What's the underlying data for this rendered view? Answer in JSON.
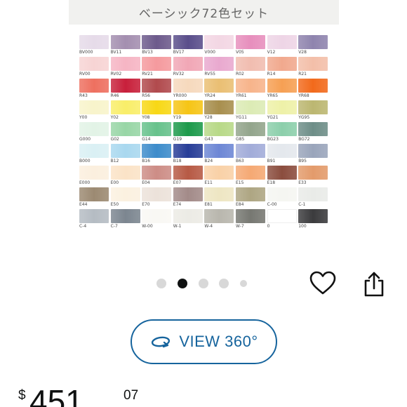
{
  "header": {
    "title": "ベーシック72色セット"
  },
  "swatches": [
    {
      "label": "BV000",
      "color": "#e6dbe9"
    },
    {
      "label": "BV11",
      "color": "#a48fb0"
    },
    {
      "label": "BV13",
      "color": "#6d5a8c"
    },
    {
      "label": "BV17",
      "color": "#5a4e8b"
    },
    {
      "label": "V000",
      "color": "#f3d7e4"
    },
    {
      "label": "V05",
      "color": "#e78fbd"
    },
    {
      "label": "V12",
      "color": "#eed5e6"
    },
    {
      "label": "V28",
      "color": "#8f84ae"
    },
    {
      "label": "RV00",
      "color": "#f7d4d4"
    },
    {
      "label": "RV02",
      "color": "#f6b5c4"
    },
    {
      "label": "RV21",
      "color": "#f59a9e"
    },
    {
      "label": "RV32",
      "color": "#f1a7b6"
    },
    {
      "label": "RV55",
      "color": "#e9a9cf"
    },
    {
      "label": "R02",
      "color": "#f1bdb0"
    },
    {
      "label": "R14",
      "color": "#f1a98e"
    },
    {
      "label": "R21",
      "color": "#f3bfa9"
    },
    {
      "label": "R43",
      "color": "#ee7060"
    },
    {
      "label": "R46",
      "color": "#c8203b"
    },
    {
      "label": "R56",
      "color": "#b14a4d"
    },
    {
      "label": "YR000",
      "color": "#f6d9bd"
    },
    {
      "label": "YR24",
      "color": "#eabf73"
    },
    {
      "label": "YR61",
      "color": "#f7b48b"
    },
    {
      "label": "YR65",
      "color": "#f6a054"
    },
    {
      "label": "YR68",
      "color": "#f26a1c"
    },
    {
      "label": "Y00",
      "color": "#f8f4cb"
    },
    {
      "label": "Y02",
      "color": "#f9ee69"
    },
    {
      "label": "Y08",
      "color": "#f8d815"
    },
    {
      "label": "Y19",
      "color": "#f6c516"
    },
    {
      "label": "Y28",
      "color": "#a88f4e"
    },
    {
      "label": "YG11",
      "color": "#dcebb5"
    },
    {
      "label": "YG21",
      "color": "#eef1a8"
    },
    {
      "label": "YG95",
      "color": "#bcb771"
    },
    {
      "label": "G000",
      "color": "#e2f3e6"
    },
    {
      "label": "G02",
      "color": "#98d6a6"
    },
    {
      "label": "G14",
      "color": "#67c28c"
    },
    {
      "label": "G19",
      "color": "#1d9a4b"
    },
    {
      "label": "G43",
      "color": "#b8d988"
    },
    {
      "label": "G85",
      "color": "#93a58c"
    },
    {
      "label": "BG23",
      "color": "#8ccfab"
    },
    {
      "label": "BG72",
      "color": "#6e8e88"
    },
    {
      "label": "B000",
      "color": "#daf0f4"
    },
    {
      "label": "B12",
      "color": "#a9d8ef"
    },
    {
      "label": "B16",
      "color": "#3d8ccb"
    },
    {
      "label": "B18",
      "color": "#283e98"
    },
    {
      "label": "B24",
      "color": "#6d87d5"
    },
    {
      "label": "B63",
      "color": "#a2acd9"
    },
    {
      "label": "B91",
      "color": "#e4e8ed"
    },
    {
      "label": "B95",
      "color": "#9aa5bb"
    },
    {
      "label": "E000",
      "color": "#fbefde"
    },
    {
      "label": "E00",
      "color": "#fbe3c7"
    },
    {
      "label": "E04",
      "color": "#cd8d86"
    },
    {
      "label": "E07",
      "color": "#b75a45"
    },
    {
      "label": "E11",
      "color": "#f9d1a7"
    },
    {
      "label": "E15",
      "color": "#f5a974"
    },
    {
      "label": "E18",
      "color": "#8b4d3e"
    },
    {
      "label": "E33",
      "color": "#e39b6b"
    },
    {
      "label": "E44",
      "color": "#9c8a72"
    },
    {
      "label": "E50",
      "color": "#fbf1e0"
    },
    {
      "label": "E70",
      "color": "#ece2da"
    },
    {
      "label": "E74",
      "color": "#a38b89"
    },
    {
      "label": "E81",
      "color": "#eee6c3"
    },
    {
      "label": "E84",
      "color": "#aea683"
    },
    {
      "label": "C-00",
      "color": "#f5f6f2"
    },
    {
      "label": "C-1",
      "color": "#e9ebe8"
    },
    {
      "label": "C-4",
      "color": "#b5bcc3"
    },
    {
      "label": "C-7",
      "color": "#7c8690"
    },
    {
      "label": "W-00",
      "color": "#f9f8f4"
    },
    {
      "label": "W-1",
      "color": "#ecebe5"
    },
    {
      "label": "W-4",
      "color": "#b9b7ae"
    },
    {
      "label": "W-7",
      "color": "#777872"
    },
    {
      "label": "0",
      "color": "#ffffff"
    },
    {
      "label": "100",
      "color": "#3b3b3d"
    }
  ],
  "carousel": {
    "count": 5,
    "active_index": 1
  },
  "actions": {
    "favorite_icon": "heart-outline-icon",
    "share_icon": "share-icon"
  },
  "view360": {
    "label": "VIEW 360°",
    "icon": "rotate-360-icon",
    "accent": "#16649d"
  },
  "price": {
    "symbol": "$",
    "whole": "451",
    "fraction": "07"
  }
}
